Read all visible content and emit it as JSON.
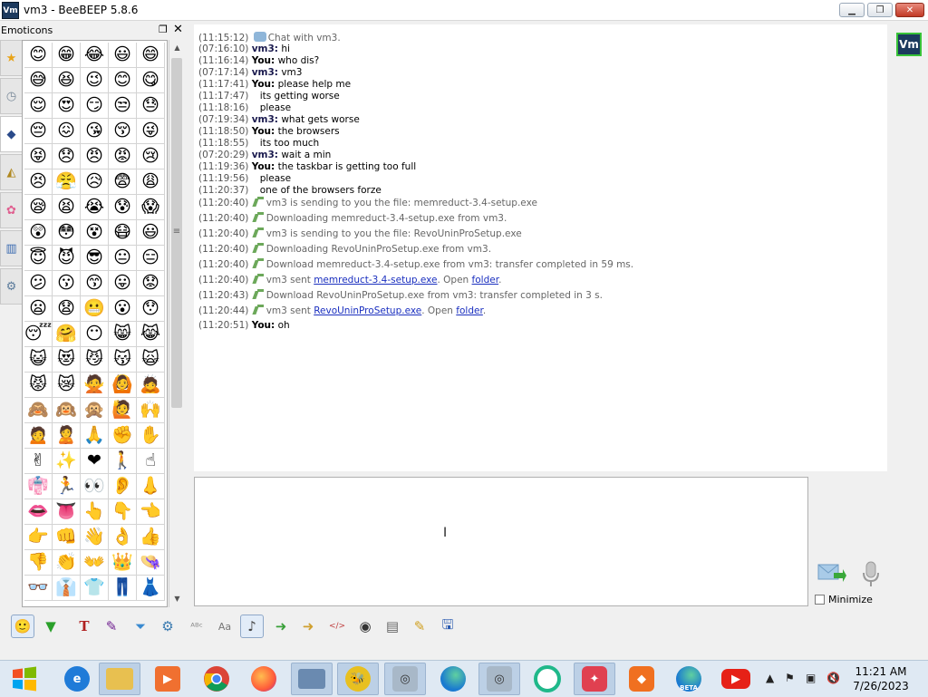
{
  "window": {
    "title": "vm3 - BeeBEEP 5.8.6",
    "app_icon": "Vm"
  },
  "emoticons": {
    "title": "Emoticons",
    "tabs": [
      "star-icon",
      "clock-icon",
      "people-icon",
      "bell-icon",
      "flower-icon",
      "building-icon",
      "gear-icon"
    ],
    "grid": [
      "😊",
      "😁",
      "😂",
      "😃",
      "😄",
      "😅",
      "😆",
      "😉",
      "😊",
      "😋",
      "😌",
      "😍",
      "😏",
      "😒",
      "😓",
      "😔",
      "😖",
      "😘",
      "😚",
      "😜",
      "😝",
      "😞",
      "😠",
      "😡",
      "😢",
      "😣",
      "😤",
      "😥",
      "😨",
      "😩",
      "😪",
      "😫",
      "😭",
      "😰",
      "😱",
      "😲",
      "😳",
      "😵",
      "😷",
      "😃",
      "😇",
      "😈",
      "😎",
      "😐",
      "😑",
      "😕",
      "😗",
      "😙",
      "😛",
      "😟",
      "😦",
      "😧",
      "😬",
      "😮",
      "😯",
      "😴",
      "🤗",
      "😶",
      "😸",
      "😹",
      "😺",
      "😻",
      "😼",
      "😽",
      "🙀",
      "😾",
      "😿",
      "🙅",
      "🙆",
      "🙇",
      "🙈",
      "🙉",
      "🙊",
      "🙋",
      "🙌",
      "🙍",
      "🙎",
      "🙏",
      "✊",
      "✋",
      "✌",
      "✨",
      "❤",
      "🚶",
      "☝",
      "👘",
      "🏃",
      "👀",
      "👂",
      "👃",
      "👄",
      "👅",
      "👆",
      "👇",
      "👈",
      "👉",
      "👊",
      "👋",
      "👌",
      "👍",
      "👎",
      "👏",
      "👐",
      "👑",
      "👒",
      "👓",
      "👔",
      "👕",
      "👖",
      "👗"
    ]
  },
  "chat": {
    "messages": [
      {
        "ts": "(11:15:12)",
        "type": "chat",
        "text": "Chat with vm3."
      },
      {
        "ts": "(07:16:10)",
        "type": "vm",
        "who": "vm3:",
        "text": "hi"
      },
      {
        "ts": "(11:16:14)",
        "type": "you",
        "who": "You:",
        "text": "who dis?"
      },
      {
        "ts": "(07:17:14)",
        "type": "vm",
        "who": "vm3:",
        "text": "vm3"
      },
      {
        "ts": "(11:17:41)",
        "type": "you",
        "who": "You:",
        "text": "please help me"
      },
      {
        "ts": "(11:17:47)",
        "type": "cont",
        "text": "its getting worse"
      },
      {
        "ts": "(11:18:16)",
        "type": "cont",
        "text": "please"
      },
      {
        "ts": "(07:19:34)",
        "type": "vm",
        "who": "vm3:",
        "text": "what gets worse"
      },
      {
        "ts": "(11:18:50)",
        "type": "you",
        "who": "You:",
        "text": "the browsers"
      },
      {
        "ts": "(11:18:55)",
        "type": "cont",
        "text": "its too much"
      },
      {
        "ts": "(07:20:29)",
        "type": "vm",
        "who": "vm3:",
        "text": "wait a min"
      },
      {
        "ts": "(11:19:36)",
        "type": "you",
        "who": "You:",
        "text": "the taskbar is getting too full"
      },
      {
        "ts": "(11:19:56)",
        "type": "cont",
        "text": "please"
      },
      {
        "ts": "(11:20:37)",
        "type": "cont",
        "text": "one of the browsers forze"
      },
      {
        "ts": "(11:20:40)",
        "type": "file",
        "text": "vm3 is sending to you the file: memreduct-3.4-setup.exe"
      },
      {
        "ts": "(11:20:40)",
        "type": "file",
        "text": "Downloading memreduct-3.4-setup.exe from vm3."
      },
      {
        "ts": "(11:20:40)",
        "type": "file",
        "text": "vm3 is sending to you the file: RevoUninProSetup.exe"
      },
      {
        "ts": "(11:20:40)",
        "type": "file",
        "text": "Downloading RevoUninProSetup.exe from vm3."
      },
      {
        "ts": "(11:20:40)",
        "type": "file",
        "text": "Download memreduct-3.4-setup.exe from vm3: transfer completed in 59 ms."
      },
      {
        "ts": "(11:20:40)",
        "type": "sent",
        "pre": "vm3 sent ",
        "file": "memreduct-3.4-setup.exe",
        "mid": ". Open ",
        "folder": "folder",
        "post": "."
      },
      {
        "ts": "(11:20:43)",
        "type": "file",
        "text": "Download RevoUninProSetup.exe from vm3: transfer completed in 3 s."
      },
      {
        "ts": "(11:20:44)",
        "type": "sent",
        "pre": "vm3 sent ",
        "file": "RevoUninProSetup.exe",
        "mid": ". Open ",
        "folder": "folder",
        "post": "."
      },
      {
        "ts": "(11:20:51)",
        "type": "you",
        "who": "You:",
        "text": "oh"
      }
    ]
  },
  "sidebar": {
    "user_badge": "Vm"
  },
  "composer": {
    "value": "",
    "minimize_label": "Minimize"
  },
  "toolbar": {
    "icons": [
      "emoticon-icon",
      "bubble-color-icon",
      "text-color-icon",
      "font-icon",
      "filter-icon",
      "settings-icon",
      "spellcheck-icon",
      "dictionary-icon",
      "music-icon",
      "send-file-icon",
      "send-folder-icon",
      "html-icon",
      "screenshot-icon",
      "save-chat-icon",
      "notes-icon",
      "save-icon"
    ]
  },
  "taskbar": {
    "apps": [
      "start-icon",
      "edge-legacy-icon",
      "file-explorer-icon",
      "media-player-icon",
      "chrome-icon",
      "firefox-icon",
      "remote-desktop-icon",
      "beebeep-icon",
      "installer-icon",
      "edge-icon",
      "installer-2-icon",
      "opera-icon",
      "app-icon",
      "brave-icon",
      "edge-beta-icon",
      "youtube-icon"
    ],
    "time": "11:21 AM",
    "date": "7/26/2023"
  }
}
